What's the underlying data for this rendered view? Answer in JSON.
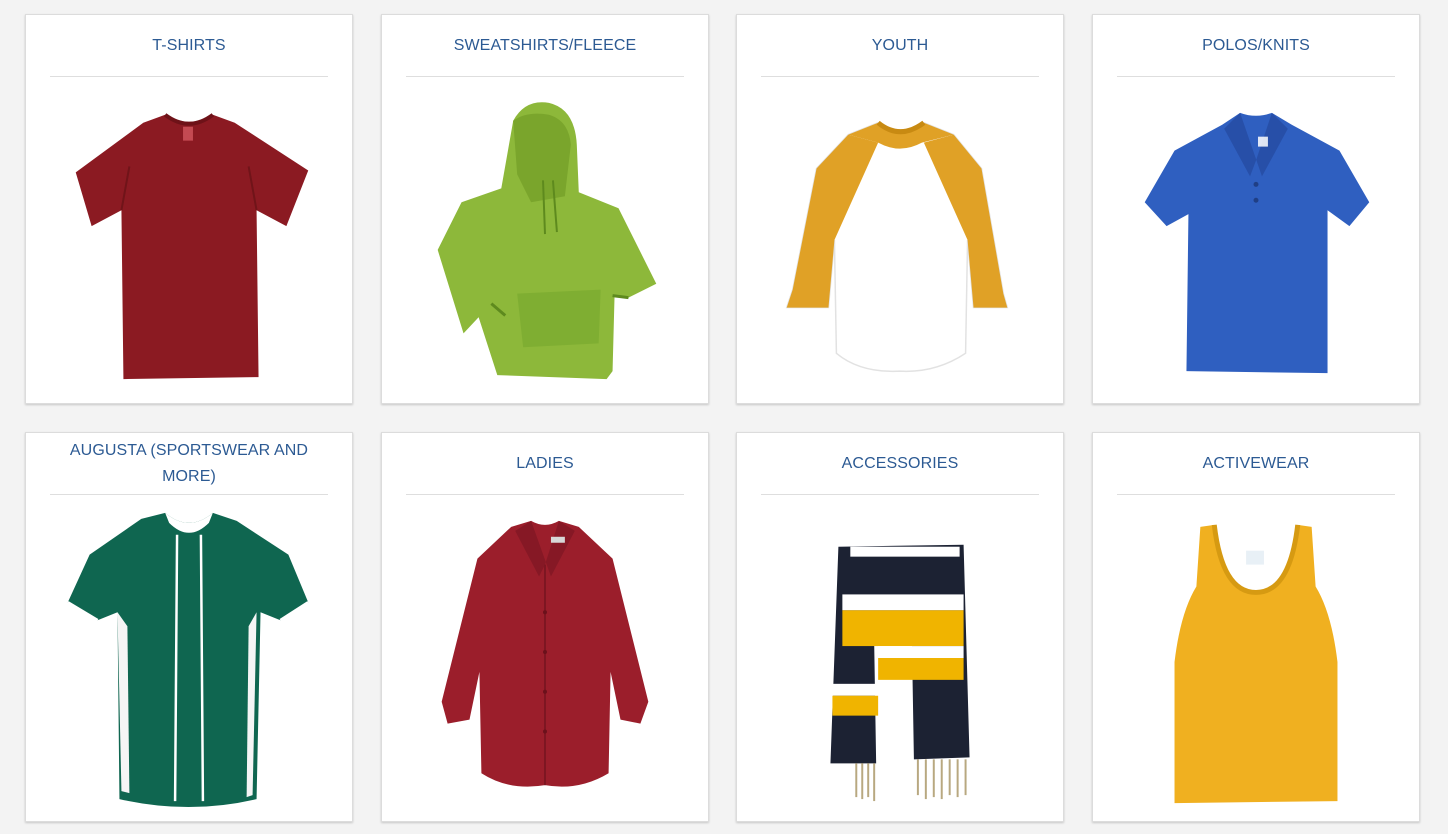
{
  "categories": [
    {
      "label": "T-SHIRTS",
      "icon": "red-tshirt-icon",
      "color": "#8b1a22"
    },
    {
      "label": "SWEATSHIRTS/FLEECE",
      "icon": "green-hoodie-icon",
      "color": "#8db83a"
    },
    {
      "label": "YOUTH",
      "icon": "raglan-shirt-icon",
      "color": "#e0a126"
    },
    {
      "label": "POLOS/KNITS",
      "icon": "blue-polo-icon",
      "color": "#2f5fc0"
    },
    {
      "label": "AUGUSTA (SPORTSWEAR AND MORE)",
      "icon": "green-baseball-jersey-icon",
      "color": "#0f6650"
    },
    {
      "label": "LADIES",
      "icon": "red-blouse-icon",
      "color": "#9b1e2b"
    },
    {
      "label": "ACCESSORIES",
      "icon": "striped-scarf-icon",
      "color": "#1c2233"
    },
    {
      "label": "ACTIVEWEAR",
      "icon": "gold-tank-top-icon",
      "color": "#f0b020"
    }
  ],
  "colors": {
    "background": "#f3f3f3",
    "card": "#ffffff",
    "title": "#2c5a93",
    "divider": "#dedede"
  }
}
